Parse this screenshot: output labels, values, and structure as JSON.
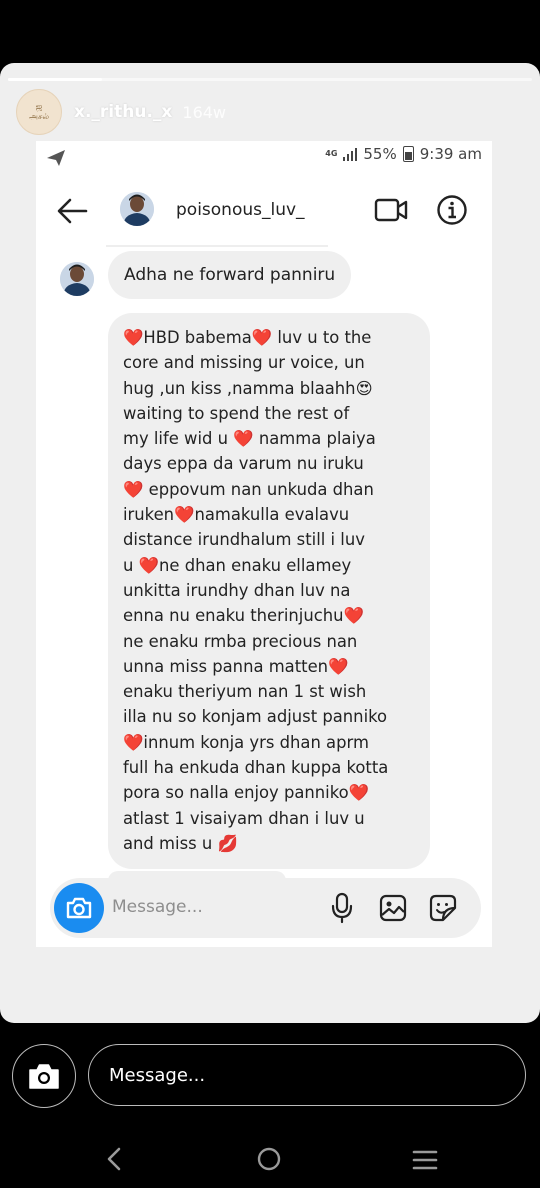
{
  "story": {
    "username": "x._rithu._x",
    "time_ago": "164w",
    "avatar_text": "ஜ\nஅசல்",
    "progress": 0.18
  },
  "status_bar": {
    "network": "4G",
    "battery": "55%",
    "time": "9:39 am"
  },
  "chat": {
    "contact_name": "poisonous_luv_",
    "message_short": "Adha ne forward panniru",
    "message_long_lines": [
      "❤️HBD babema❤️ luv u to the",
      "core and missing ur voice, un",
      "hug ,un kiss ,namma blaahh😍",
      "waiting to spend the rest of",
      "my life wid u ❤️ namma plaiya",
      "days eppa da varum nu iruku",
      "❤️ eppovum nan unkuda dhan",
      "iruken❤️namakulla evalavu",
      "distance irundhalum still i luv",
      "u ❤️ne dhan enaku ellamey",
      "unkitta irundhy dhan luv na",
      "enna nu enaku therinjuchu❤️",
      "ne enaku rmba precious nan",
      "unna miss panna matten❤️",
      "enaku theriyum nan 1 st wish",
      "illa nu so konjam adjust panniko",
      "❤️innum konja yrs dhan aprm",
      "full ha enkuda dhan kuppa kotta",
      "pora so nalla enjoy panniko❤️",
      "atlast 1 visaiyam dhan i luv u",
      "and miss u 💋"
    ],
    "composer_placeholder": "Message..."
  },
  "reply": {
    "placeholder": "Message..."
  },
  "icons": {
    "send": "send-icon",
    "back": "back-arrow-icon",
    "video": "video-call-icon",
    "info": "info-icon",
    "camera": "camera-icon",
    "mic": "microphone-icon",
    "gallery": "gallery-icon",
    "sticker": "sticker-icon",
    "nav_back": "nav-back-icon",
    "nav_home": "nav-home-icon",
    "nav_recent": "nav-recent-apps-icon"
  },
  "colors": {
    "background": "#000000",
    "story_card": "#efefef",
    "bubble": "#efefef",
    "camera_button": "#1a8cf0"
  }
}
